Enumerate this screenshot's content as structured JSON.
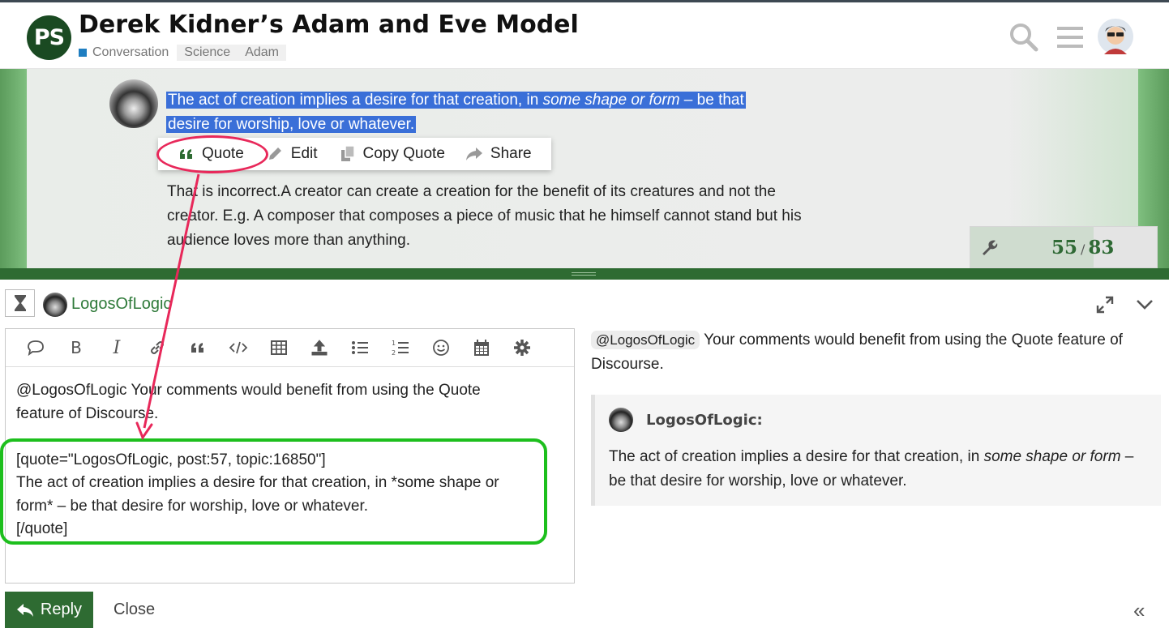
{
  "header": {
    "logo_text": "PS",
    "title": "Derek Kidner’s Adam and Eve Model",
    "category": "Conversation",
    "category_color": "#1f7ec1",
    "tags": [
      "Science",
      "Adam"
    ]
  },
  "post": {
    "selected_line1": "The act of creation implies a desire for that creation, in ",
    "selected_italic": "some shape or form",
    "selected_line1_end": " – be that",
    "selected_line2": "desire for worship, love or whatever.",
    "body": "That is incorrect.A creator can create a creation for the benefit of its creatures and not the creator. E.g. A composer that composes a piece of music that he himself cannot stand but his audience loves more than anything."
  },
  "selection_popup": {
    "quote_label": "Quote",
    "edit_label": "Edit",
    "copy_quote_label": "Copy Quote",
    "share_label": "Share"
  },
  "progress": {
    "current": "55",
    "separator": "/",
    "total": "83",
    "fraction": 0.66
  },
  "composer": {
    "username": "LogosOfLogic",
    "editor_text": "@LogosOfLogic Your comments would benefit from using the Quote\nfeature of Discourse.\n\n[quote=\"LogosOfLogic, post:57, topic:16850\"]\nThe act of creation implies a desire for that creation, in *some shape or\nform* – be that desire for worship, love or whatever.\n[/quote]",
    "reply_label": "Reply",
    "close_label": "Close"
  },
  "preview": {
    "mention": "@LogosOfLogic",
    "intro": " Your comments would benefit from using the Quote feature of Discourse.",
    "quote_author": "LogosOfLogic:",
    "quote_text_before": "The act of creation implies a desire for that creation, in ",
    "quote_text_italic": "some shape or form",
    "quote_text_after": " – be that desire for worship, love or whatever."
  },
  "colors": {
    "brand_green": "#2e6b32",
    "selection": "#3a6fd8",
    "annotation_red": "#e8285a",
    "annotation_green": "#1dbf1d"
  }
}
